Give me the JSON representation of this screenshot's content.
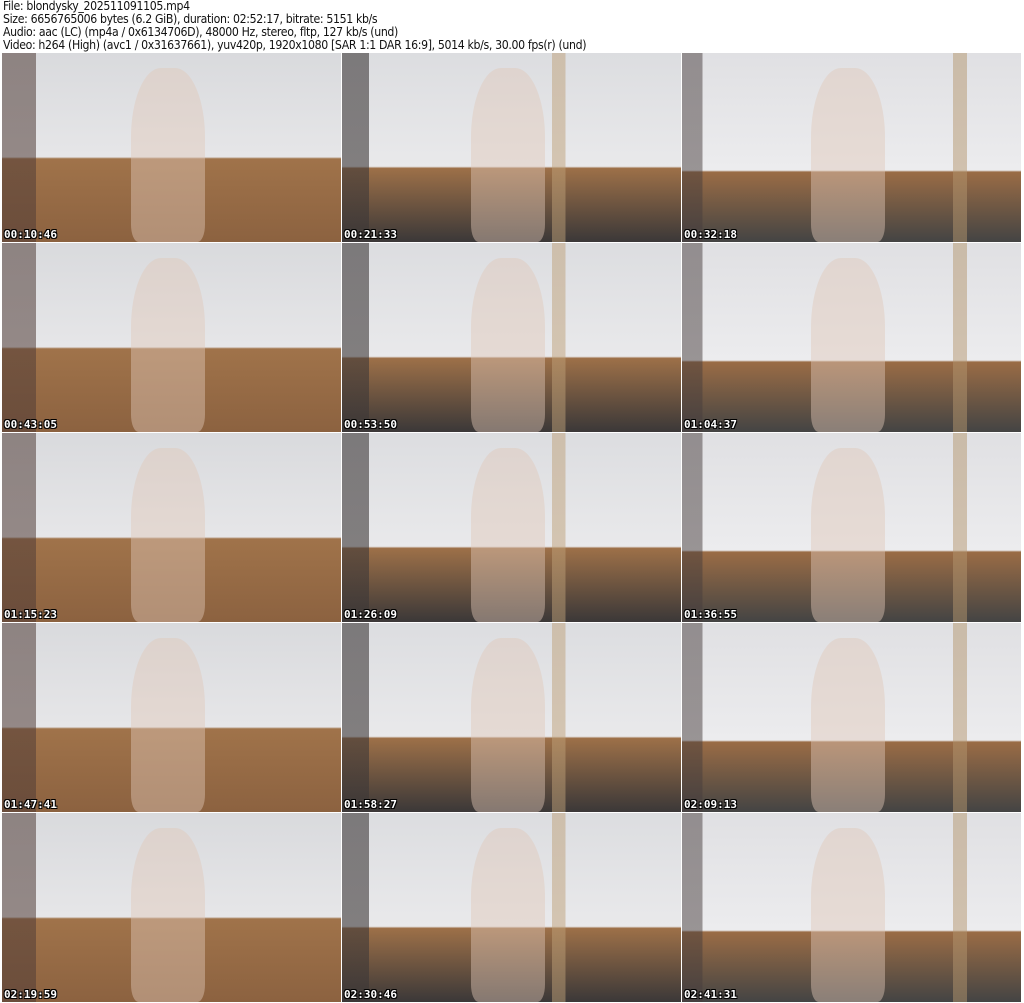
{
  "header": {
    "file": "File: blondysky_202511091105.mp4",
    "size": "Size: 6656765006 bytes (6.2 GiB), duration: 02:52:17, bitrate: 5151 kb/s",
    "audio": "Audio: aac (LC) (mp4a / 0x6134706D), 48000 Hz, stereo, fltp, 127 kb/s (und)",
    "video": "Video: h264 (High) (avc1 / 0x31637661), yuv420p, 1920x1080 [SAR 1:1 DAR 16:9], 5014 kb/s, 30.00 fps(r) (und)"
  },
  "thumbnails": [
    {
      "timestamp": "00:10:46"
    },
    {
      "timestamp": "00:21:33"
    },
    {
      "timestamp": "00:32:18"
    },
    {
      "timestamp": "00:43:05"
    },
    {
      "timestamp": "00:53:50"
    },
    {
      "timestamp": "01:04:37"
    },
    {
      "timestamp": "01:15:23"
    },
    {
      "timestamp": "01:26:09"
    },
    {
      "timestamp": "01:36:55"
    },
    {
      "timestamp": "01:47:41"
    },
    {
      "timestamp": "01:58:27"
    },
    {
      "timestamp": "02:09:13"
    },
    {
      "timestamp": "02:19:59"
    },
    {
      "timestamp": "02:30:46"
    },
    {
      "timestamp": "02:41:31"
    }
  ]
}
